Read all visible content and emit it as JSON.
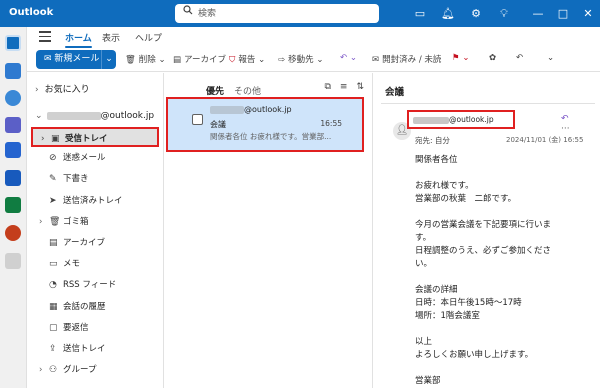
{
  "app": {
    "title": "Outlook"
  },
  "search": {
    "placeholder": "検索"
  },
  "ribbon": {
    "tabs": [
      "ホーム",
      "表示",
      "ヘルプ"
    ]
  },
  "toolbar": {
    "new_mail": "新規メール",
    "delete": "削除",
    "archive": "アーカイブ",
    "report": "報告",
    "move_to": "移動先",
    "read_unread": "開封済み / 未読"
  },
  "folders": {
    "favorites": "お気に入り",
    "account": "@outlook.jp",
    "items": [
      {
        "label": "受信トレイ",
        "icon": "inbox-icon"
      },
      {
        "label": "迷惑メール",
        "icon": "junk-icon"
      },
      {
        "label": "下書き",
        "icon": "draft-icon"
      },
      {
        "label": "送信済みトレイ",
        "icon": "sent-icon"
      },
      {
        "label": "ゴミ箱",
        "icon": "trash-icon"
      },
      {
        "label": "アーカイブ",
        "icon": "archive-icon"
      },
      {
        "label": "メモ",
        "icon": "note-icon"
      },
      {
        "label": "RSS フィード",
        "icon": "rss-icon"
      },
      {
        "label": "会話の履歴",
        "icon": "history-icon"
      },
      {
        "label": "要返信",
        "icon": "reply-needed-icon"
      },
      {
        "label": "送信トレイ",
        "icon": "outbox-icon"
      },
      {
        "label": "グループ",
        "icon": "group-icon"
      }
    ]
  },
  "list": {
    "tabs": {
      "focused": "優先",
      "other": "その他"
    },
    "message": {
      "from": "@outlook.jp",
      "subject": "会議",
      "time": "16:55",
      "preview": "関係者各位 お疲れ様です。営業部..."
    }
  },
  "reading": {
    "subject": "会議",
    "sender": "@outlook.jp",
    "to": "宛先: 自分",
    "date": "2024/11/01 (金) 16:55",
    "body": [
      "関係者各位",
      "",
      "お疲れ様です。",
      "営業部の秋葉　二郎です。",
      "",
      "今月の営業会議を下記要項に行いま",
      "す。",
      "日程調整のうえ、必ずご参加くださ",
      "い。",
      "",
      "会議の詳細",
      "日時：本日午後15時〜17時",
      "場所：1階会議室",
      "",
      "以上",
      "よろしくお願い申し上げます。",
      "",
      "営業部"
    ]
  },
  "colors": {
    "brand": "#0f6cbd",
    "highlight": "#e02020",
    "selected_bg": "#cfe4fa"
  }
}
